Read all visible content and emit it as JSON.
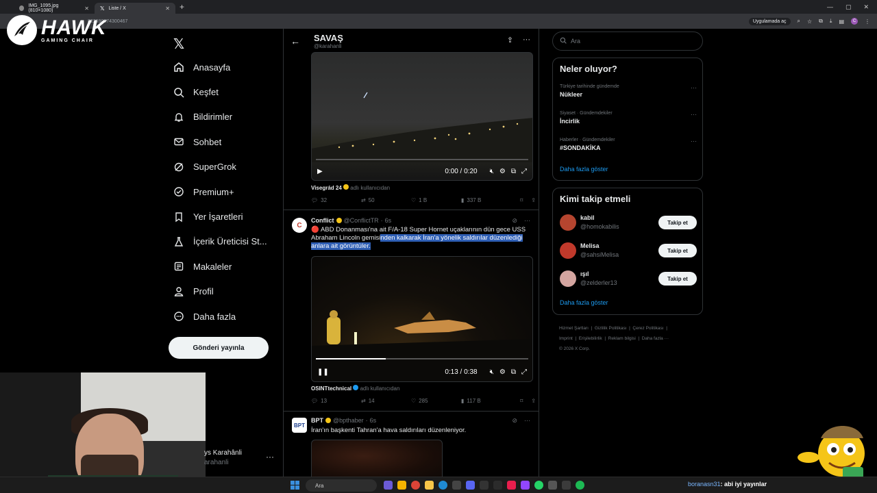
{
  "browser": {
    "tabs": [
      {
        "title": "IMG_1095.jpg (810×1080)"
      },
      {
        "title": "Liste / X"
      }
    ],
    "url": "822690074300467",
    "open_in_app": "Uygulamada aç"
  },
  "overlay": {
    "logo_main": "HAWK",
    "logo_sub": "GAMING CHAIR"
  },
  "nav": {
    "items": [
      {
        "label": "Anasayfa",
        "icon": "home-icon"
      },
      {
        "label": "Keşfet",
        "icon": "search-icon"
      },
      {
        "label": "Bildirimler",
        "icon": "bell-icon"
      },
      {
        "label": "Sohbet",
        "icon": "mail-icon"
      },
      {
        "label": "SuperGrok",
        "icon": "grok-icon"
      },
      {
        "label": "Premium+",
        "icon": "verified-icon"
      },
      {
        "label": "Yer İşaretleri",
        "icon": "bookmark-icon"
      },
      {
        "label": "İçerik Üreticisi St...",
        "icon": "flask-icon"
      },
      {
        "label": "Makaleler",
        "icon": "article-icon"
      },
      {
        "label": "Profil",
        "icon": "user-icon"
      },
      {
        "label": "Daha fazla",
        "icon": "more-circle-icon"
      }
    ],
    "post_button": "Gönderi yayınla"
  },
  "account": {
    "name": "ys Karahânli",
    "handle": "arahanli"
  },
  "list": {
    "title": "SAVAŞ",
    "handle": "@karahanli"
  },
  "posts": [
    {
      "video": {
        "time": "0:00 / 0:20",
        "progress": 0.0,
        "state": "paused"
      },
      "credit_name": "Visegrád 24",
      "credit_suffix": "adlı kullanıcıdan",
      "stats": {
        "replies": "32",
        "reposts": "50",
        "likes": "1 B",
        "views": "337 B"
      }
    },
    {
      "author": "Conflict",
      "handle": "@ConflictTR",
      "time": "6s",
      "text_plain": "🔴 ABD Donanması'na ait F/A-18 Super Hornet uçaklarının dün gece USS Abraham Lincoln gemisi",
      "text_highlight": "nden kalkarak İran'a yönelik saldırılar düzenlediği anlara ait görüntüler.",
      "video": {
        "time": "0:13 / 0:38",
        "progress": 0.33,
        "state": "playing"
      },
      "credit_name": "OSINTtechnical",
      "credit_suffix": "adlı kullanıcıdan",
      "stats": {
        "replies": "13",
        "reposts": "14",
        "likes": "285",
        "views": "117 B"
      }
    },
    {
      "author": "BPT",
      "handle": "@bpthaber",
      "time": "6s",
      "text": "İran'ın başkenti Tahran'a hava saldırıları düzenleniyor."
    }
  ],
  "right": {
    "search_placeholder": "Ara",
    "trends_title": "Neler oluyor?",
    "trends": [
      {
        "context": "Türkiye tarihinde gündemde",
        "name": "Nükleer"
      },
      {
        "context": "Siyaset · Gündemdekiler",
        "name": "İncirlik"
      },
      {
        "context": "Haberler · Gündemdekiler",
        "name": "#SONDAKİKA"
      }
    ],
    "show_more": "Daha fazla göster",
    "who_title": "Kimi takip etmeli",
    "who": [
      {
        "name": "kabil",
        "handle": "@homokabilis",
        "color": "#b5452f"
      },
      {
        "name": "Melisa",
        "handle": "@sahsiMelisa",
        "color": "#c0392b"
      },
      {
        "name": "ışıl",
        "handle": "@zelderler13",
        "color": "#d4a5a0"
      }
    ],
    "follow_label": "Takip et",
    "footer": [
      "Hizmet Şartları",
      "Gizlilik Politikası",
      "Çerez Politikası",
      "Imprint",
      "Erişilebilirlik",
      "Reklam bilgisi",
      "Daha fazla ···",
      "© 2026 X Corp."
    ]
  },
  "taskbar": {
    "search": "Ara",
    "chat_user": "boranasn31",
    "chat_msg": ": abi iyi yayınlar"
  },
  "colors": {
    "accent": "#1d9bf0",
    "highlight": "#2f5fb5",
    "gold": "#f5c518"
  }
}
